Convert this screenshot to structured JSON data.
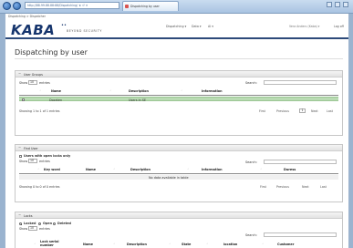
{
  "browser": {
    "address": "http://88.99.88.88:88/Dispatching/ ★ ↺ ✕",
    "tab_title": "Dispatching by user"
  },
  "breadcrumb": "Dispatching > Dispatcher",
  "brand": {
    "logo": "KABA",
    "dots": "••",
    "tagline": "BEYOND SECURITY"
  },
  "topnav": [
    "Dispatching ▾",
    "Data ▾",
    "Al ▾"
  ],
  "user_info": "Vera Anders (Kaba) ▾",
  "logout": "Log off",
  "page_title": "Dispatching by user",
  "panels": {
    "user_groups": {
      "toggle": "−",
      "title": "User Groups",
      "show_label": "Show",
      "entries_value": "10",
      "entries_label": "entries",
      "search_label": "Search:",
      "columns": [
        "Name",
        "Description",
        "Information"
      ],
      "rows": [
        {
          "name": "Dozaten",
          "description": "Users in SE",
          "information": ""
        }
      ],
      "footer": "Showing 1 to 1 of 1 entries",
      "pager": {
        "first": "First",
        "previous": "Previous",
        "current": "1",
        "next": "Next",
        "last": "Last"
      }
    },
    "find_user": {
      "toggle": "−",
      "title": "Find User",
      "filter_label": "Users with open locks only",
      "show_label": "Show",
      "entries_value": "10",
      "entries_label": "entries",
      "search_label": "Search:",
      "columns": [
        "Key word",
        "Name",
        "Description",
        "Information",
        "Duress"
      ],
      "empty_text": "No data available in table",
      "footer": "Showing 0 to 0 of 0 entries",
      "pager": {
        "first": "First",
        "previous": "Previous",
        "next": "Next",
        "last": "Last"
      }
    },
    "locks": {
      "toggle": "−",
      "title": "Locks",
      "filter_locked": "Locked",
      "filter_open": "Open",
      "filter_deleted": "Deleted",
      "show_label": "Show",
      "entries_value": "10",
      "entries_label": "entries",
      "search_label": "Search:",
      "columns": [
        "Lock serial number",
        "Name",
        "Description",
        "State",
        "location",
        "Customer"
      ]
    }
  },
  "colors": {
    "highlight_row": "#b9dbb3",
    "brand_navy": "#16356d"
  }
}
